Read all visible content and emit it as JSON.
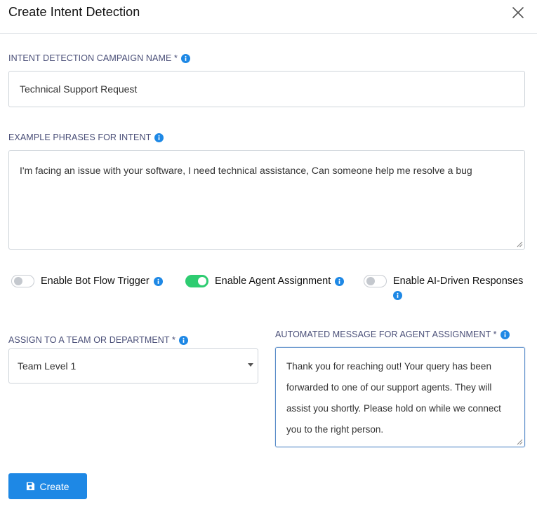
{
  "modal": {
    "title": "Create Intent Detection"
  },
  "fields": {
    "campaign_name": {
      "label": "INTENT DETECTION CAMPAIGN NAME *",
      "value": "Technical Support Request"
    },
    "example_phrases": {
      "label": "EXAMPLE PHRASES FOR INTENT",
      "value": "I'm facing an issue with your software, I need technical assistance, Can someone help me resolve a bug"
    },
    "team": {
      "label": "ASSIGN TO A TEAM OR DEPARTMENT *",
      "selected": "Team Level 1"
    },
    "automated_message": {
      "label": "AUTOMATED MESSAGE FOR AGENT ASSIGNMENT *",
      "value": "Thank you for reaching out! Your query has been forwarded to one of our support agents. They will assist you shortly. Please hold on while we connect you to the right person."
    }
  },
  "toggles": [
    {
      "label": "Enable Bot Flow Trigger",
      "enabled": false
    },
    {
      "label": "Enable Agent Assignment",
      "enabled": true
    },
    {
      "label": "Enable AI-Driven Responses",
      "enabled": false
    }
  ],
  "actions": {
    "create_label": "Create"
  },
  "colors": {
    "accent": "#1e88e5",
    "toggle_on": "#2ecc71",
    "info_icon": "#1e88e5",
    "label_text": "#4a4f78"
  },
  "icons": {
    "close": "close-icon",
    "info": "info-icon",
    "save": "save-icon",
    "caret": "caret-down-icon"
  }
}
